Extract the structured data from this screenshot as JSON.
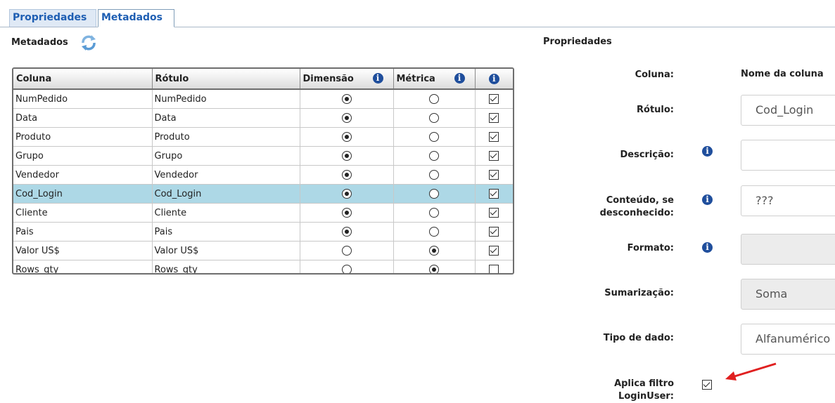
{
  "tabs": [
    {
      "label": "Propriedades",
      "active": false
    },
    {
      "label": "Metadados",
      "active": true
    }
  ],
  "left_title": "Metadados",
  "grid": {
    "headers": [
      "Coluna",
      "Rótulo",
      "Dimensão",
      "Métrica",
      ""
    ],
    "rows": [
      {
        "coluna": "NumPedido",
        "rotulo": "NumPedido",
        "dimensao": true,
        "metrica": false,
        "checked": true
      },
      {
        "coluna": "Data",
        "rotulo": "Data",
        "dimensao": true,
        "metrica": false,
        "checked": true
      },
      {
        "coluna": "Produto",
        "rotulo": "Produto",
        "dimensao": true,
        "metrica": false,
        "checked": true
      },
      {
        "coluna": "Grupo",
        "rotulo": "Grupo",
        "dimensao": true,
        "metrica": false,
        "checked": true
      },
      {
        "coluna": "Vendedor",
        "rotulo": "Vendedor",
        "dimensao": true,
        "metrica": false,
        "checked": true
      },
      {
        "coluna": "Cod_Login",
        "rotulo": "Cod_Login",
        "dimensao": true,
        "metrica": false,
        "checked": true,
        "selected": true
      },
      {
        "coluna": "Cliente",
        "rotulo": "Cliente",
        "dimensao": true,
        "metrica": false,
        "checked": true
      },
      {
        "coluna": "Pais",
        "rotulo": "Pais",
        "dimensao": true,
        "metrica": false,
        "checked": true
      },
      {
        "coluna": "Valor US$",
        "rotulo": "Valor US$",
        "dimensao": false,
        "metrica": true,
        "checked": true
      },
      {
        "coluna": "Rows_qty",
        "rotulo": "Rows_qty",
        "dimensao": false,
        "metrica": true,
        "checked": false
      }
    ]
  },
  "props": {
    "title": "Propriedades",
    "coluna_label": "Coluna:",
    "coluna_value": "Nome da coluna",
    "rotulo_label": "Rótulo:",
    "rotulo_value": "Cod_Login",
    "descricao_label": "Descrição:",
    "descricao_value": "",
    "conteudo_label_1": "Conteúdo, se",
    "conteudo_label_2": "desconhecido:",
    "conteudo_value": "???",
    "formato_label": "Formato:",
    "formato_value": "",
    "sumarizacao_label": "Sumarização:",
    "sumarizacao_value": "Soma",
    "tipo_label": "Tipo de dado:",
    "tipo_value": "Alfanumérico",
    "filtro_label_1": "Aplica filtro",
    "filtro_label_2": "LoginUser:",
    "filtro_checked": true
  },
  "colors": {
    "accent": "#1f5fb3",
    "selected_row": "#add8e6",
    "arrow": "#e02020",
    "info": "#1f4e9c"
  },
  "icons": {
    "refresh": "refresh-icon",
    "info": "info-icon",
    "annotation": "red-arrow"
  }
}
